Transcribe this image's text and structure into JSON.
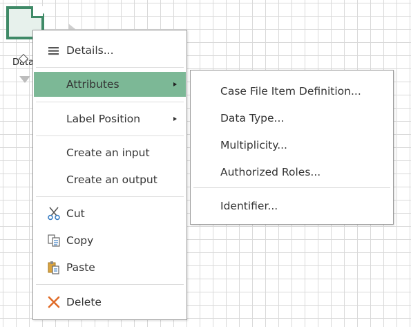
{
  "canvas": {
    "grid_color": "#d9d9d9",
    "data_object": {
      "label": "Data",
      "color": "#3f8a67",
      "fill": "#e7f1ec"
    }
  },
  "context_menu": {
    "highlight_color": "#7cb896",
    "items": [
      {
        "label": "Details...",
        "icon": "list-icon"
      },
      {
        "label": "Attributes",
        "has_submenu": true,
        "highlighted": true
      },
      {
        "label": "Label Position",
        "has_submenu": true
      },
      {
        "label": "Create an input"
      },
      {
        "label": "Create an output"
      },
      {
        "label": "Cut",
        "icon": "scissors-icon"
      },
      {
        "label": "Copy",
        "icon": "copy-icon"
      },
      {
        "label": "Paste",
        "icon": "paste-icon"
      },
      {
        "label": "Delete",
        "icon": "delete-x-icon",
        "icon_color": "#e06a26"
      }
    ]
  },
  "attributes_submenu": {
    "items": [
      {
        "label": "Case File Item Definition..."
      },
      {
        "label": "Data Type..."
      },
      {
        "label": "Multiplicity..."
      },
      {
        "label": "Authorized Roles..."
      },
      {
        "label": "Identifier..."
      }
    ]
  }
}
